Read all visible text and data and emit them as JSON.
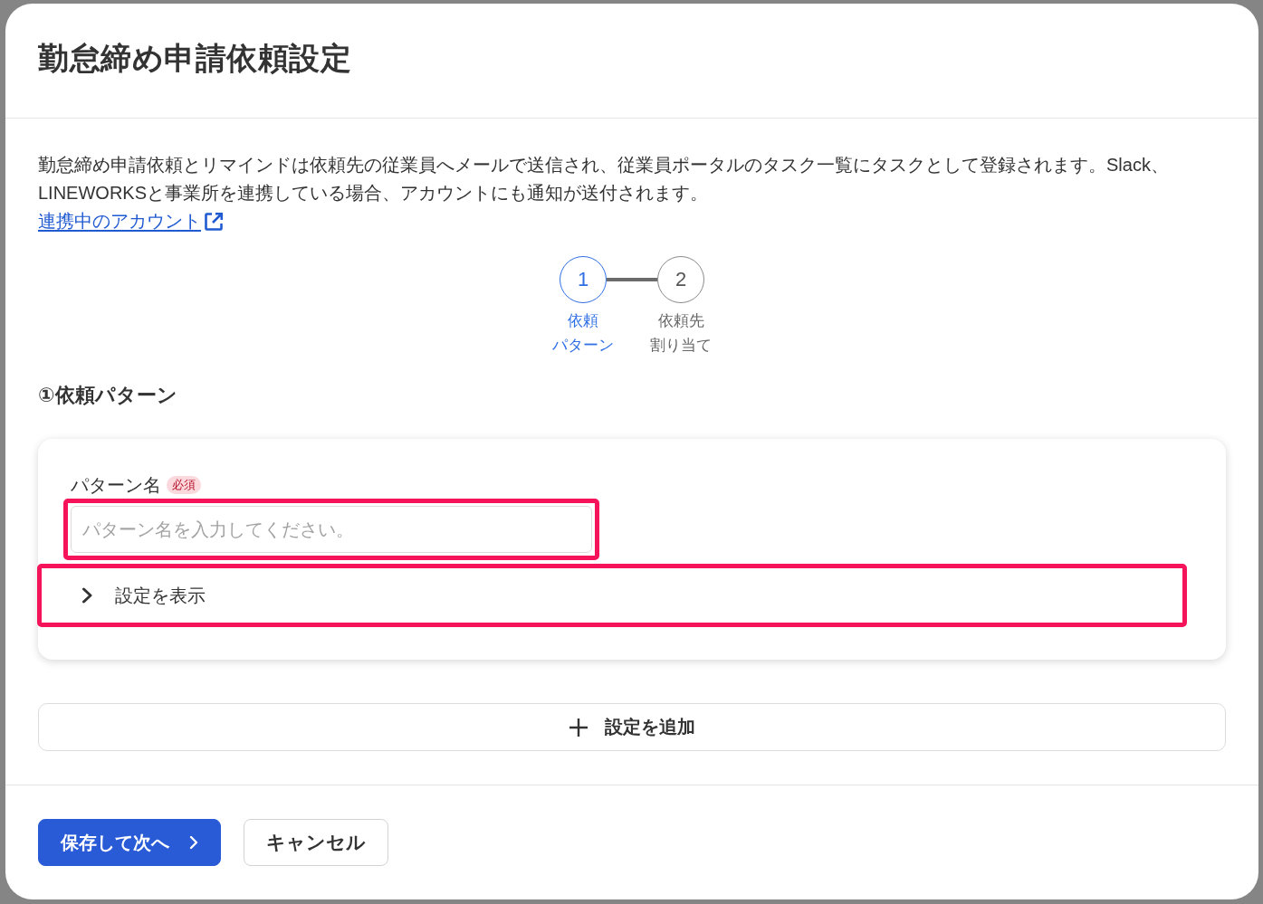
{
  "dialog": {
    "title": "勤怠締め申請依頼設定",
    "description": "勤怠締め申請依頼とリマインドは依頼先の従業員へメールで送信され、従業員ポータルのタスク一覧にタスクとして登録されます。Slack、LINEWORKSと事業所を連携している場合、アカウントにも通知が送付されます。",
    "link": {
      "label": "連携中のアカウント"
    },
    "steps": [
      {
        "number": "1",
        "label_lines": [
          "依頼",
          "パターン"
        ],
        "selected": true
      },
      {
        "number": "2",
        "label_lines": [
          "依頼先",
          "割り当て"
        ],
        "selected": false
      }
    ],
    "section_title": "①依頼パターン",
    "pattern_card": {
      "field": {
        "label": "パターン名",
        "badge": "必須",
        "placeholder": "パターン名を入力してください。",
        "highlighted": true
      },
      "settings_toggle": {
        "label": "設定を表示",
        "expanded": false,
        "highlighted": true
      }
    },
    "add_button": {
      "label": "設定を追加"
    },
    "buttons": [
      {
        "label": "保存して次へ",
        "kind": "primary"
      },
      {
        "label": "キャンセル",
        "kind": "secondary"
      }
    ]
  }
}
